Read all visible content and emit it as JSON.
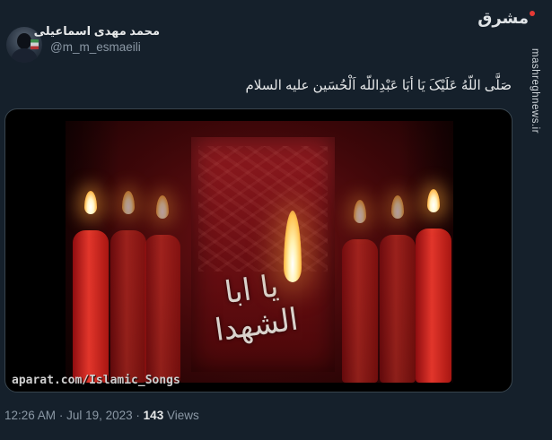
{
  "author": {
    "display_name": "محمد مهدی اسماعیلی",
    "handle": "@m_m_esmaeili",
    "avatar_icon": "user-avatar-photo"
  },
  "watermark": {
    "logo_text": "مشرق",
    "side_text": "mashreghnews.ir",
    "accent_color": "#e53935"
  },
  "tweet": {
    "text": "صَلَّی اللّهُ عَلَیْکَ یَا أبَا عَبْدِاللّه اَلْحُسَین علیه السلام"
  },
  "media": {
    "type": "video-thumbnail",
    "calligraphy_text": "یا ابا الشهدا",
    "caption": "aparat.com/Islamic_Songs"
  },
  "footer": {
    "time": "12:26 AM",
    "separator": "·",
    "date": "Jul 19, 2023",
    "views_count": "143",
    "views_label": "Views"
  },
  "colors": {
    "background": "#15202b",
    "text_primary": "#e7e9ea",
    "text_secondary": "#8b98a5",
    "border": "#38444d"
  }
}
